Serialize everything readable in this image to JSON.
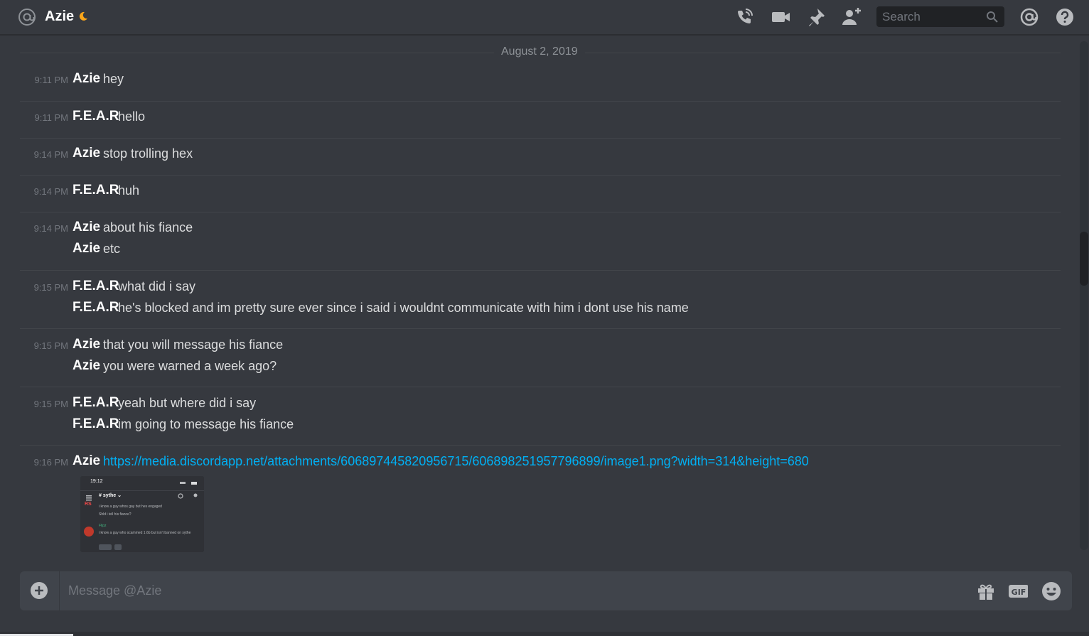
{
  "header": {
    "title": "Azie"
  },
  "search": {
    "placeholder": "Search"
  },
  "date_divider": "August 2, 2019",
  "messages": [
    {
      "time": "9:11 PM",
      "lines": [
        {
          "author": "Azie",
          "text": "hey"
        }
      ]
    },
    {
      "time": "9:11 PM",
      "lines": [
        {
          "author": "F.E.A.R",
          "text": "hello"
        }
      ]
    },
    {
      "time": "9:14 PM",
      "lines": [
        {
          "author": "Azie",
          "text": "stop trolling hex"
        }
      ]
    },
    {
      "time": "9:14 PM",
      "lines": [
        {
          "author": "F.E.A.R",
          "text": "huh"
        }
      ]
    },
    {
      "time": "9:14 PM",
      "lines": [
        {
          "author": "Azie",
          "text": "about his fiance"
        },
        {
          "author": "Azie",
          "text": "etc"
        }
      ]
    },
    {
      "time": "9:15 PM",
      "lines": [
        {
          "author": "F.E.A.R",
          "text": "what did i say"
        },
        {
          "author": "F.E.A.R",
          "text": "he's blocked and im pretty sure ever since i said i wouldnt communicate with him i dont use his name"
        }
      ]
    },
    {
      "time": "9:15 PM",
      "lines": [
        {
          "author": "Azie",
          "text": "that you will message his fiance"
        },
        {
          "author": "Azie",
          "text": "you were warned a week ago?"
        }
      ]
    },
    {
      "time": "9:15 PM",
      "lines": [
        {
          "author": "F.E.A.R",
          "text": "yeah but where did i say"
        },
        {
          "author": "F.E.A.R",
          "text": "im going to message his fiance"
        }
      ]
    },
    {
      "time": "9:16 PM",
      "lines": [
        {
          "author": "Azie",
          "link": "https://media.discordapp.net/attachments/606897445820956715/606898251957796899/image1.png?width=314&height=680"
        }
      ]
    }
  ],
  "attachment_preview": {
    "status_time": "19:12",
    "channel": "# sythe ⌄",
    "line1": "i know a guy whos gay but hes engaged",
    "line2": "Shld i tell his fiance?",
    "name2": "Flipz",
    "line3": "i know a guy who scammed 1.6b but isn't banned on sythe",
    "badge1": "RS"
  },
  "composer": {
    "placeholder": "Message @Azie"
  },
  "colors": {
    "background": "#36393f",
    "link": "#00b0f4",
    "idle_status": "#faa61a"
  },
  "icons": [
    "at-icon",
    "moon-icon",
    "phone-call-icon",
    "video-call-icon",
    "pin-icon",
    "add-friend-icon",
    "search-icon",
    "mention-icon",
    "help-icon",
    "plus-circle-icon",
    "gift-icon",
    "gif-icon",
    "emoji-icon"
  ]
}
